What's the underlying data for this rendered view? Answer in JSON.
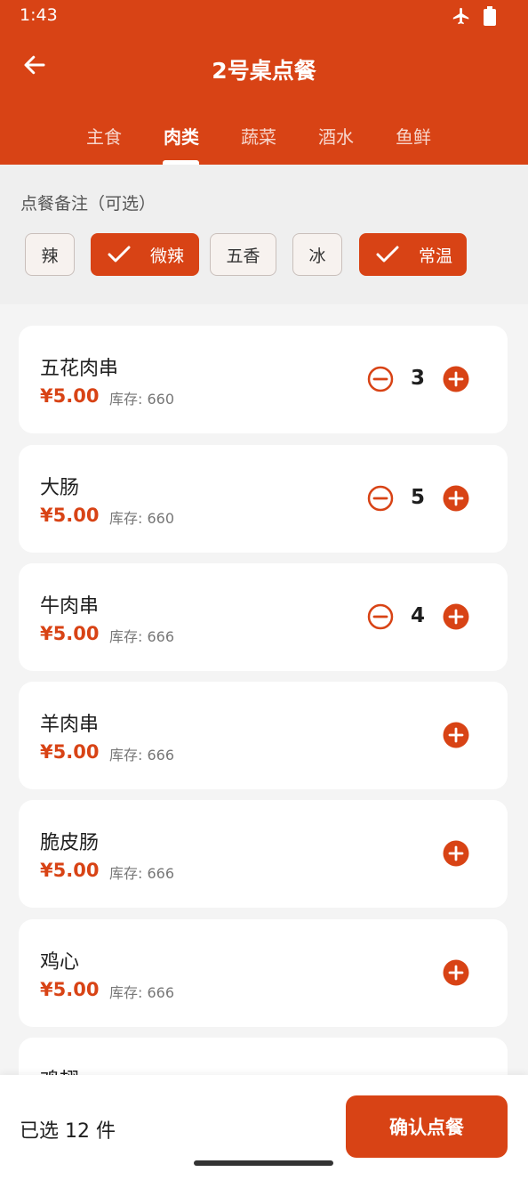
{
  "status_bar": {
    "time": "1:43",
    "icons": [
      "airplane-icon",
      "battery-icon"
    ]
  },
  "app_bar": {
    "title": "2号桌点餐",
    "back_icon": "arrow-left-icon"
  },
  "tabs": [
    {
      "label": "主食",
      "active": false
    },
    {
      "label": "肉类",
      "active": true
    },
    {
      "label": "蔬菜",
      "active": false
    },
    {
      "label": "酒水",
      "active": false
    },
    {
      "label": "鱼鲜",
      "active": false
    }
  ],
  "notes": {
    "label": "点餐备注（可选）",
    "chips": [
      {
        "label": "辣",
        "selected": false
      },
      {
        "label": "微辣",
        "selected": true
      },
      {
        "label": "五香",
        "selected": false
      },
      {
        "label": "冰",
        "selected": false
      },
      {
        "label": "常温",
        "selected": true
      }
    ]
  },
  "items": [
    {
      "name": "五花肉串",
      "price": "¥5.00",
      "stock": "库存: 660",
      "qty": "3"
    },
    {
      "name": "大肠",
      "price": "¥5.00",
      "stock": "库存: 660",
      "qty": "5"
    },
    {
      "name": "牛肉串",
      "price": "¥5.00",
      "stock": "库存: 666",
      "qty": "4"
    },
    {
      "name": "羊肉串",
      "price": "¥5.00",
      "stock": "库存: 666",
      "qty": ""
    },
    {
      "name": "脆皮肠",
      "price": "¥5.00",
      "stock": "库存: 666",
      "qty": ""
    },
    {
      "name": "鸡心",
      "price": "¥5.00",
      "stock": "库存: 666",
      "qty": ""
    },
    {
      "name": "鸡翅",
      "price": "",
      "stock": "",
      "qty": ""
    }
  ],
  "bottom_bar": {
    "selected_text": "已选 12 件",
    "confirm_label": "确认点餐"
  },
  "colors": {
    "accent": "#d84315",
    "background": "#f4f4f4",
    "card": "#ffffff"
  }
}
